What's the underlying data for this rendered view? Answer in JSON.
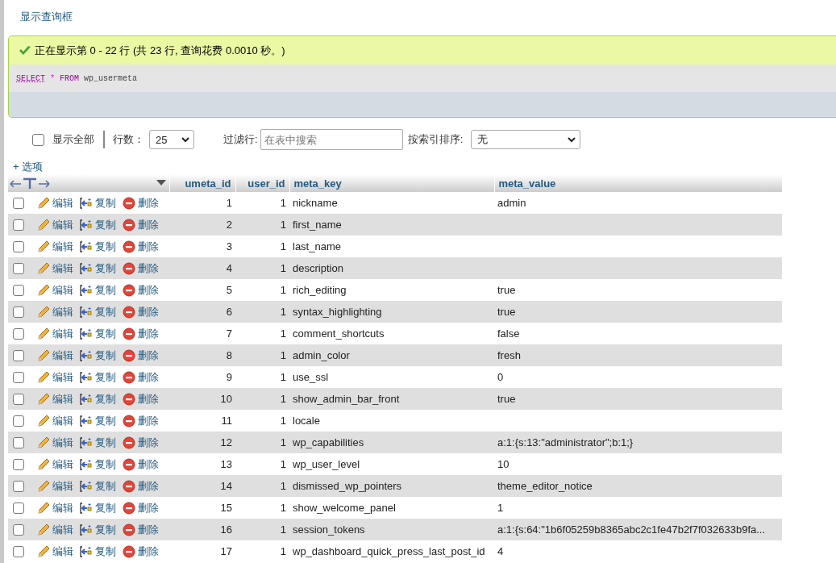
{
  "query_toggle": "显示查询框",
  "message": {
    "kind": "success",
    "text": "正在显示第 0 - 22 行 (共 23 行, 查询花费 0.0010 秒。)"
  },
  "sql": [
    {
      "kind": "keyword",
      "text": "SELECT"
    },
    {
      "kind": "operator",
      "text": "*"
    },
    {
      "kind": "keyword",
      "text": "FROM"
    },
    {
      "kind": "identifier",
      "text": "wp_usermeta"
    }
  ],
  "controls": {
    "show_all": {
      "label": "显示全部",
      "checked": false
    },
    "rows_label": "行数：",
    "rows_value": "25",
    "filter_label": "过滤行:",
    "filter_placeholder": "在表中搜索",
    "sort_label": "按索引排序:",
    "sort_value": "无"
  },
  "options_link": "+ 选项",
  "table": {
    "columns": [
      "umeta_id",
      "user_id",
      "meta_key",
      "meta_value"
    ],
    "rows": [
      {
        "checked": false,
        "actions": [
          {
            "kind": "edit",
            "label": "编辑"
          },
          {
            "kind": "copy",
            "label": "复制"
          },
          {
            "kind": "delete",
            "label": "删除"
          }
        ],
        "cells": [
          "1",
          "1",
          "nickname",
          "admin"
        ]
      },
      {
        "checked": false,
        "actions": [
          {
            "kind": "edit",
            "label": "编辑"
          },
          {
            "kind": "copy",
            "label": "复制"
          },
          {
            "kind": "delete",
            "label": "删除"
          }
        ],
        "cells": [
          "2",
          "1",
          "first_name",
          ""
        ]
      },
      {
        "checked": false,
        "actions": [
          {
            "kind": "edit",
            "label": "编辑"
          },
          {
            "kind": "copy",
            "label": "复制"
          },
          {
            "kind": "delete",
            "label": "删除"
          }
        ],
        "cells": [
          "3",
          "1",
          "last_name",
          ""
        ]
      },
      {
        "checked": false,
        "actions": [
          {
            "kind": "edit",
            "label": "编辑"
          },
          {
            "kind": "copy",
            "label": "复制"
          },
          {
            "kind": "delete",
            "label": "删除"
          }
        ],
        "cells": [
          "4",
          "1",
          "description",
          ""
        ]
      },
      {
        "checked": false,
        "actions": [
          {
            "kind": "edit",
            "label": "编辑"
          },
          {
            "kind": "copy",
            "label": "复制"
          },
          {
            "kind": "delete",
            "label": "删除"
          }
        ],
        "cells": [
          "5",
          "1",
          "rich_editing",
          "true"
        ]
      },
      {
        "checked": false,
        "actions": [
          {
            "kind": "edit",
            "label": "编辑"
          },
          {
            "kind": "copy",
            "label": "复制"
          },
          {
            "kind": "delete",
            "label": "删除"
          }
        ],
        "cells": [
          "6",
          "1",
          "syntax_highlighting",
          "true"
        ]
      },
      {
        "checked": false,
        "actions": [
          {
            "kind": "edit",
            "label": "编辑"
          },
          {
            "kind": "copy",
            "label": "复制"
          },
          {
            "kind": "delete",
            "label": "删除"
          }
        ],
        "cells": [
          "7",
          "1",
          "comment_shortcuts",
          "false"
        ]
      },
      {
        "checked": false,
        "actions": [
          {
            "kind": "edit",
            "label": "编辑"
          },
          {
            "kind": "copy",
            "label": "复制"
          },
          {
            "kind": "delete",
            "label": "删除"
          }
        ],
        "cells": [
          "8",
          "1",
          "admin_color",
          "fresh"
        ]
      },
      {
        "checked": false,
        "actions": [
          {
            "kind": "edit",
            "label": "编辑"
          },
          {
            "kind": "copy",
            "label": "复制"
          },
          {
            "kind": "delete",
            "label": "删除"
          }
        ],
        "cells": [
          "9",
          "1",
          "use_ssl",
          "0"
        ]
      },
      {
        "checked": false,
        "actions": [
          {
            "kind": "edit",
            "label": "编辑"
          },
          {
            "kind": "copy",
            "label": "复制"
          },
          {
            "kind": "delete",
            "label": "删除"
          }
        ],
        "cells": [
          "10",
          "1",
          "show_admin_bar_front",
          "true"
        ]
      },
      {
        "checked": false,
        "actions": [
          {
            "kind": "edit",
            "label": "编辑"
          },
          {
            "kind": "copy",
            "label": "复制"
          },
          {
            "kind": "delete",
            "label": "删除"
          }
        ],
        "cells": [
          "11",
          "1",
          "locale",
          ""
        ]
      },
      {
        "checked": false,
        "actions": [
          {
            "kind": "edit",
            "label": "编辑"
          },
          {
            "kind": "copy",
            "label": "复制"
          },
          {
            "kind": "delete",
            "label": "删除"
          }
        ],
        "cells": [
          "12",
          "1",
          "wp_capabilities",
          "a:1:{s:13:\"administrator\";b:1;}"
        ]
      },
      {
        "checked": false,
        "actions": [
          {
            "kind": "edit",
            "label": "编辑"
          },
          {
            "kind": "copy",
            "label": "复制"
          },
          {
            "kind": "delete",
            "label": "删除"
          }
        ],
        "cells": [
          "13",
          "1",
          "wp_user_level",
          "10"
        ]
      },
      {
        "checked": false,
        "actions": [
          {
            "kind": "edit",
            "label": "编辑"
          },
          {
            "kind": "copy",
            "label": "复制"
          },
          {
            "kind": "delete",
            "label": "删除"
          }
        ],
        "cells": [
          "14",
          "1",
          "dismissed_wp_pointers",
          "theme_editor_notice"
        ]
      },
      {
        "checked": false,
        "actions": [
          {
            "kind": "edit",
            "label": "编辑"
          },
          {
            "kind": "copy",
            "label": "复制"
          },
          {
            "kind": "delete",
            "label": "删除"
          }
        ],
        "cells": [
          "15",
          "1",
          "show_welcome_panel",
          "1"
        ]
      },
      {
        "checked": false,
        "actions": [
          {
            "kind": "edit",
            "label": "编辑"
          },
          {
            "kind": "copy",
            "label": "复制"
          },
          {
            "kind": "delete",
            "label": "删除"
          }
        ],
        "cells": [
          "16",
          "1",
          "session_tokens",
          "a:1:{s:64:\"1b6f05259b8365abc2c1fe47b2f7f032633b9fa..."
        ]
      },
      {
        "checked": false,
        "actions": [
          {
            "kind": "edit",
            "label": "编辑"
          },
          {
            "kind": "copy",
            "label": "复制"
          },
          {
            "kind": "delete",
            "label": "删除"
          }
        ],
        "cells": [
          "17",
          "1",
          "wp_dashboard_quick_press_last_post_id",
          "4"
        ]
      }
    ]
  }
}
